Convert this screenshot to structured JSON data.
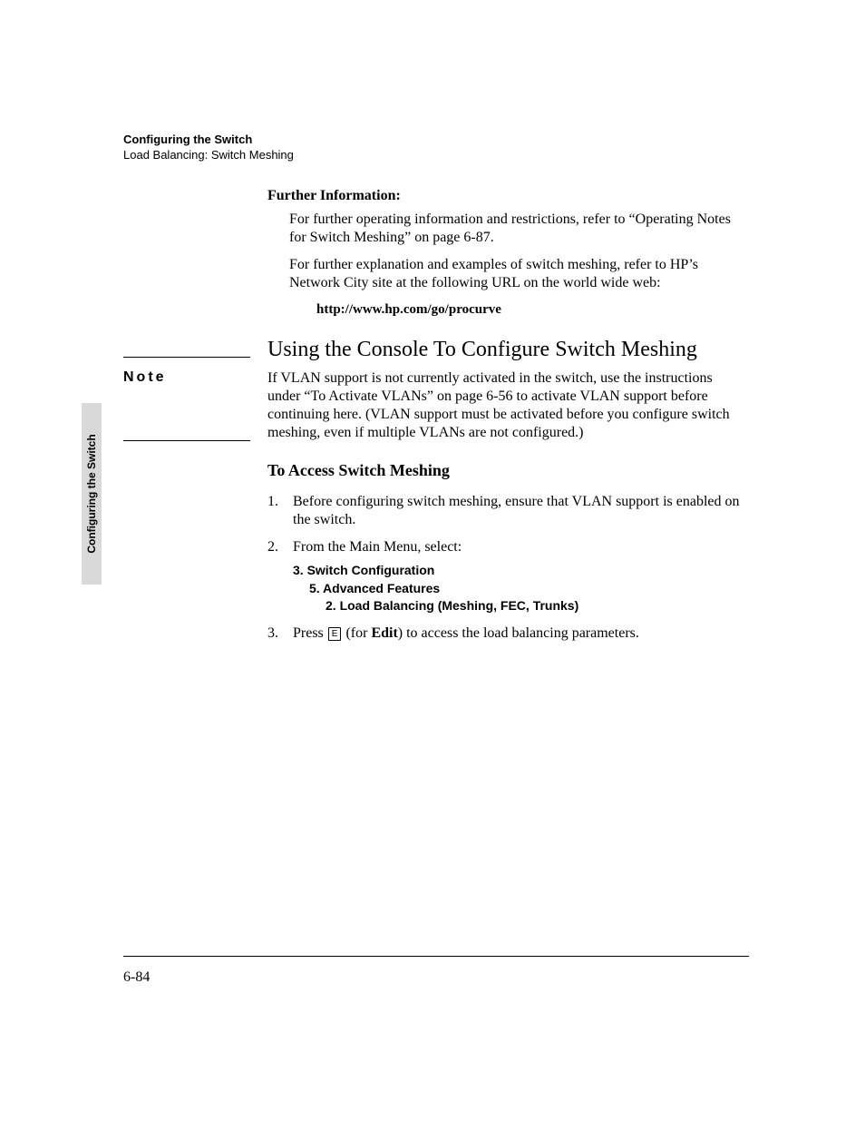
{
  "sideTab": "Configuring the Switch",
  "header": {
    "title": "Configuring the Switch",
    "subtitle": "Load Balancing: Switch Meshing"
  },
  "further": {
    "heading": "Further Information:",
    "p1": "For further operating information and restrictions, refer to “Operating Notes for Switch Meshing” on page 6-87.",
    "p2": "For further explanation and examples of switch meshing, refer to HP’s Network City site at the following URL on the world wide web:",
    "url": "http://www.hp.com/go/procurve"
  },
  "sectionTitle": "Using the Console To Configure Switch Meshing",
  "note": {
    "label": "Note",
    "body": "If VLAN support is not currently activated in the switch, use the instructions under “To Activate VLANs” on page 6-56 to activate VLAN support before continuing here. (VLAN support must be activated before you configure switch meshing, even if multiple VLANs are not configured.)"
  },
  "subsectionTitle": "To Access Switch Meshing",
  "steps": {
    "s1": {
      "num": "1.",
      "text": "Before configuring switch meshing, ensure that VLAN support is enabled on the switch."
    },
    "s2": {
      "num": "2.",
      "text": "From the Main Menu, select:"
    },
    "s3": {
      "num": "3.",
      "pre": "Press ",
      "key": "E",
      "mid": " (for ",
      "bold": "Edit",
      "post": ") to access the load balancing parameters."
    }
  },
  "menuPath": {
    "l1": "3. Switch Configuration",
    "l2": "5. Advanced Features",
    "l3": "2. Load Balancing (Meshing, FEC, Trunks)"
  },
  "pageNumber": "6-84"
}
